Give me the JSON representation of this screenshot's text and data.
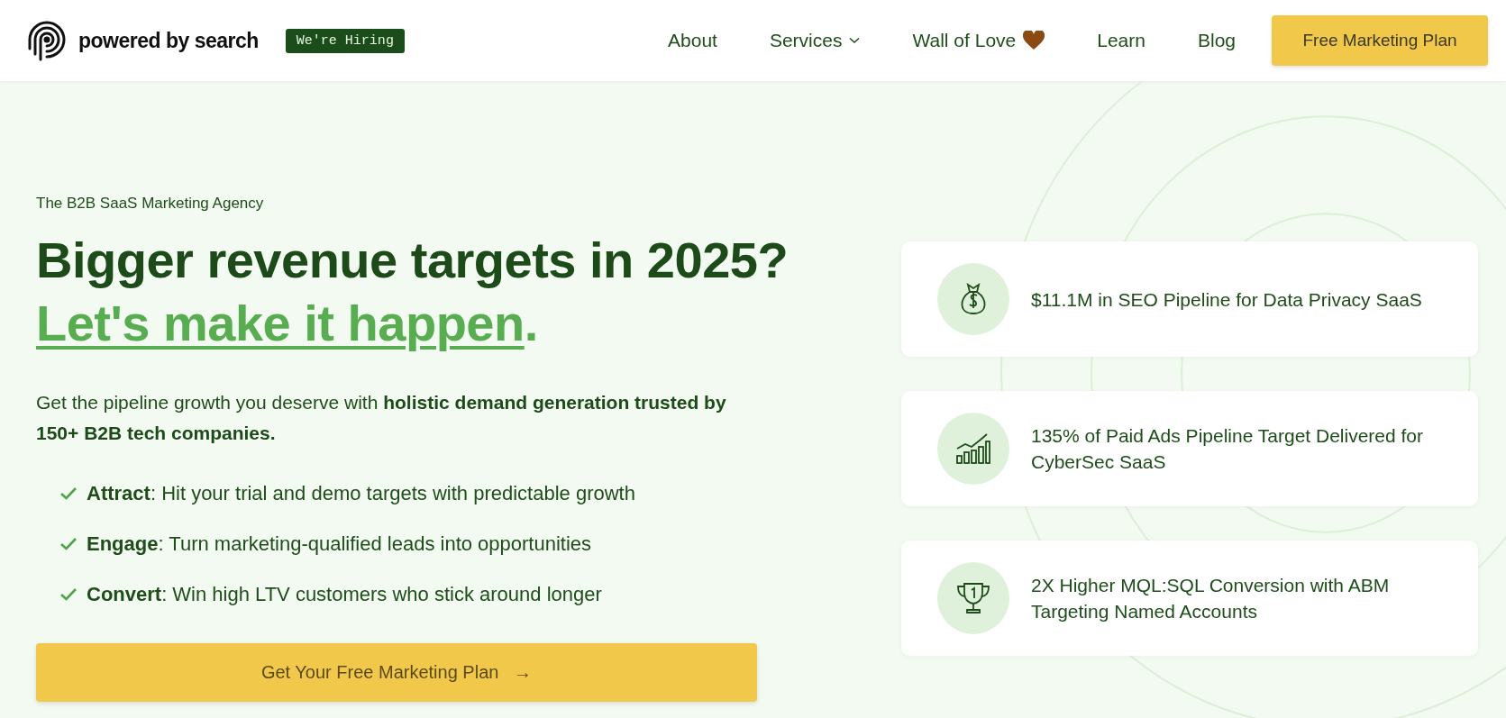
{
  "header": {
    "brand": "powered by search",
    "badge": "We're Hiring",
    "nav": [
      {
        "label": "About",
        "kind": "link"
      },
      {
        "label": "Services",
        "kind": "dropdown"
      },
      {
        "label": "Wall of Love",
        "kind": "heart"
      },
      {
        "label": "Learn",
        "kind": "link"
      },
      {
        "label": "Blog",
        "kind": "link"
      }
    ],
    "cta": "Free Marketing Plan"
  },
  "hero": {
    "eyebrow": "The B2B SaaS Marketing Agency",
    "heading": "Bigger revenue targets in 2025?",
    "heading_link": "Let's make it happen",
    "heading_end": ".",
    "intro": "Get the pipeline growth you deserve with **holistic demand generation trusted by 150+ B2B tech companies.**",
    "points": [
      "**Attract**: Hit your trial and demo targets with predictable growth",
      "**Engage**: Turn marketing-qualified leads into opportunities",
      "**Convert**: Win high LTV customers who stick around longer"
    ],
    "button": "Get Your Free Marketing Plan",
    "button_arrow": "→"
  },
  "results": [
    {
      "kind": "money-bag",
      "text": "$11.1M in SEO Pipeline for Data Privacy SaaS"
    },
    {
      "kind": "chart",
      "text": "135% of Paid Ads Pipeline Target Delivered for CyberSec SaaS"
    },
    {
      "kind": "trophy",
      "text": "2X Higher MQL:SQL Conversion with ABM Targeting Named Accounts"
    }
  ]
}
